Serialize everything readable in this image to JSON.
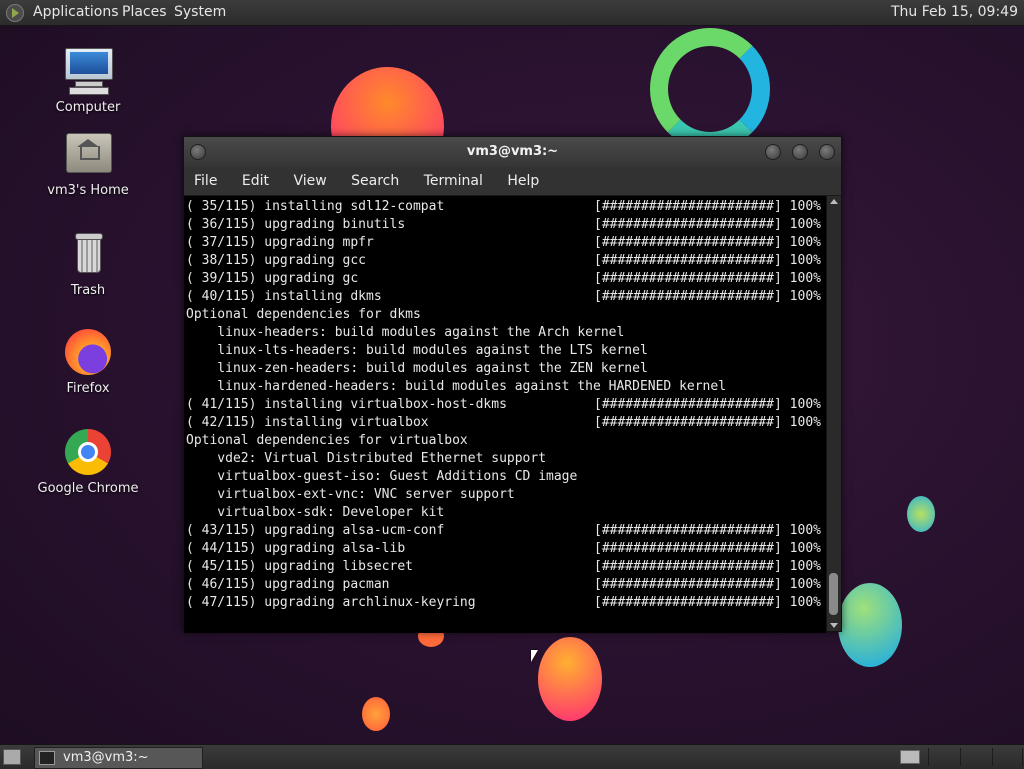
{
  "top_panel": {
    "menus": [
      "Applications",
      "Places",
      "System"
    ],
    "clock": "Thu Feb 15, 09:49"
  },
  "desktop_icons": [
    {
      "label": "Computer",
      "icon": "computer-icon"
    },
    {
      "label": "vm3's Home",
      "icon": "home-folder-icon"
    },
    {
      "label": "Trash",
      "icon": "trash-icon"
    },
    {
      "label": "Firefox",
      "icon": "firefox-icon"
    },
    {
      "label": "Google Chrome",
      "icon": "chrome-icon"
    }
  ],
  "window": {
    "title": "vm3@vm3:~",
    "menus": [
      "File",
      "Edit",
      "View",
      "Search",
      "Terminal",
      "Help"
    ]
  },
  "terminal": {
    "progress_bar": "[######################]",
    "lines": [
      {
        "text": "( 35/115) installing sdl12-compat",
        "pct": "100%"
      },
      {
        "text": "( 36/115) upgrading binutils",
        "pct": "100%"
      },
      {
        "text": "( 37/115) upgrading mpfr",
        "pct": "100%"
      },
      {
        "text": "( 38/115) upgrading gcc",
        "pct": "100%"
      },
      {
        "text": "( 39/115) upgrading gc",
        "pct": "100%"
      },
      {
        "text": "( 40/115) installing dkms",
        "pct": "100%"
      },
      {
        "text": "Optional dependencies for dkms",
        "pct": ""
      },
      {
        "text": "    linux-headers: build modules against the Arch kernel",
        "pct": ""
      },
      {
        "text": "    linux-lts-headers: build modules against the LTS kernel",
        "pct": ""
      },
      {
        "text": "    linux-zen-headers: build modules against the ZEN kernel",
        "pct": ""
      },
      {
        "text": "    linux-hardened-headers: build modules against the HARDENED kernel",
        "pct": ""
      },
      {
        "text": "( 41/115) installing virtualbox-host-dkms",
        "pct": "100%"
      },
      {
        "text": "( 42/115) installing virtualbox",
        "pct": "100%"
      },
      {
        "text": "Optional dependencies for virtualbox",
        "pct": ""
      },
      {
        "text": "    vde2: Virtual Distributed Ethernet support",
        "pct": ""
      },
      {
        "text": "    virtualbox-guest-iso: Guest Additions CD image",
        "pct": ""
      },
      {
        "text": "    virtualbox-ext-vnc: VNC server support",
        "pct": ""
      },
      {
        "text": "    virtualbox-sdk: Developer kit",
        "pct": ""
      },
      {
        "text": "( 43/115) upgrading alsa-ucm-conf",
        "pct": "100%"
      },
      {
        "text": "( 44/115) upgrading alsa-lib",
        "pct": "100%"
      },
      {
        "text": "( 45/115) upgrading libsecret",
        "pct": "100%"
      },
      {
        "text": "( 46/115) upgrading pacman",
        "pct": "100%"
      },
      {
        "text": "( 47/115) upgrading archlinux-keyring",
        "pct": "100%"
      }
    ]
  },
  "taskbar": {
    "window_button": "vm3@vm3:~"
  }
}
